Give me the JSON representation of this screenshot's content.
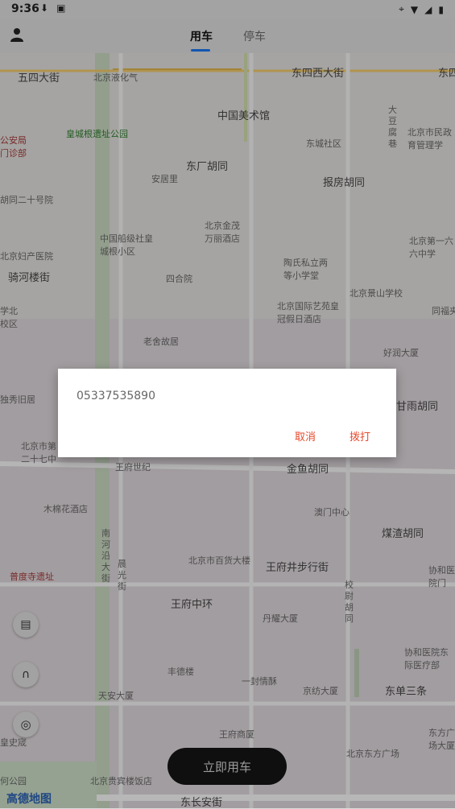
{
  "status_bar": {
    "time": "9:36"
  },
  "top_nav": {
    "tabs": [
      {
        "label": "用车",
        "active": true
      },
      {
        "label": "停车",
        "active": false
      }
    ]
  },
  "map": {
    "labels": [
      "五四大街",
      "北京液化气",
      "东四西大街",
      "东四",
      "中国美术馆",
      "大豆腐巷",
      "北京市民政育管理学",
      "公安局门诊部",
      "皇城根遗址公园",
      "东城社区",
      "东厂胡同",
      "安居里",
      "报房胡同",
      "胡同二十号院",
      "北京金茂万丽酒店",
      "北京第一六六中学",
      "中国船级社皇城根小区",
      "北京妇产医院",
      "骑河楼街",
      "陶氏私立两等小学堂",
      "四合院",
      "北京景山学校",
      "学北校区",
      "北京国际艺苑皇冠假日酒店",
      "同福夹",
      "老舍故居",
      "好润大厦",
      "独秀旧居",
      "甘雨胡同",
      "北京市第二十七中",
      "王府世纪",
      "金鱼胡同",
      "木棉花酒店",
      "澳门中心",
      "煤渣胡同",
      "南河沿大街",
      "晨光街",
      "北京市百货大楼",
      "王府井步行街",
      "协和医院门",
      "普度寺遗址",
      "王府中环",
      "校尉胡同",
      "丹耀大厦",
      "协和医院东际医疗部",
      "丰德楼",
      "一封情酥",
      "京纺大厦",
      "东单三条",
      "天安大厦",
      "王府商厦",
      "北京东方广场",
      "东方广场大厦",
      "北京贵宾楼饭店",
      "皇史宬",
      "何公园",
      "东长安街"
    ],
    "logo_text": "高德地图"
  },
  "dialog": {
    "phone_number": "05337535890",
    "cancel_label": "取消",
    "call_label": "拨打"
  },
  "book_button": {
    "label": "立即用车"
  },
  "colors": {
    "accent": "#1a73e8",
    "dialog_action": "#e64a2c",
    "button_bg": "#141414"
  }
}
